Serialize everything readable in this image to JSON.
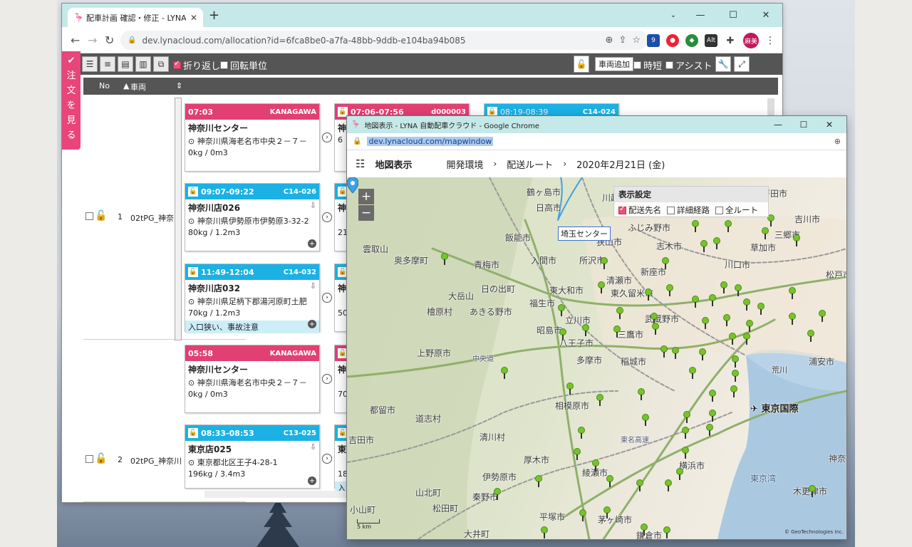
{
  "main_window": {
    "tab_title": "配車計画 確認・修正 - LYNA 自動",
    "url": "dev.lynacloud.com/allocation?id=6fca8be0-a7fa-48bb-9ddb-e104ba94b085",
    "avatar_label": "麻美"
  },
  "toolbar": {
    "wrap_label": "折り返し",
    "rotation_label": "回転単位",
    "add_vehicle_label": "車両追加",
    "shortcut_label": "時短",
    "assist_label": "アシスト"
  },
  "side_button": {
    "label_chars": [
      "注",
      "文",
      "を",
      "見",
      "る"
    ]
  },
  "table": {
    "col_no": "No",
    "col_vehicle": "車両"
  },
  "rows": [
    {
      "no": "1",
      "vehicle": "02tPG_神奈"
    },
    {
      "no": "2",
      "vehicle": "02tPG_神奈川"
    }
  ],
  "cards": [
    {
      "time": "07:03",
      "code": "KANAGAWA",
      "name": "神奈川センター",
      "address": "神奈川県海老名市中央２－７－",
      "load": "0kg / 0m3"
    },
    {
      "time": "09:07-09:22",
      "code": "C14-026",
      "name": "神奈川店026",
      "address": "神奈川県伊勢原市伊勢原3-32-2",
      "load": "80kg / 1.2m3"
    },
    {
      "time": "11:49-12:04",
      "code": "C14-032",
      "name": "神奈川店032",
      "address": "神奈川県足柄下郡湯河原町土肥",
      "load": "70kg / 1.2m3",
      "note": "入口狭い、事故注意"
    },
    {
      "time": "05:58",
      "code": "KANAGAWA",
      "name": "神奈川センター",
      "address": "神奈川県海老名市中央２－７－",
      "load": "0kg / 0m3"
    },
    {
      "time": "08:33-08:53",
      "code": "C13-025",
      "name": "東京店025",
      "address": "東京都北区王子4-28-1",
      "load": "196kg / 3.4m3"
    }
  ],
  "cards_col2": [
    {
      "time": "07:06-07:56",
      "code": "d000003"
    },
    {
      "time": "08:19-08:39",
      "code": "C14-024"
    }
  ],
  "cards_col2_fragments": [
    "神奈",
    "6",
    "神奈",
    "21",
    "神奈",
    "50",
    "神奈",
    "70",
    "東京",
    "18",
    "入"
  ],
  "map_window": {
    "title": "地図表示 - LYNA 自動配車クラウド - Google Chrome",
    "url": "dev.lynacloud.com/mapwindow",
    "header_title": "地図表示",
    "crumbs": [
      "開発環境",
      "配送ルート",
      "2020年2月21日 (金)"
    ],
    "settings_title": "表示設定",
    "opt_destination": "配送先名",
    "opt_detail_route": "詳細経路",
    "opt_all_routes": "全ルート",
    "center_label": "埼玉センター",
    "scale": "5 km",
    "copyright": "© GeoTechnologies Inc."
  },
  "places": [
    {
      "name": "鶴ヶ島市"
    },
    {
      "name": "日高市"
    },
    {
      "name": "川越"
    },
    {
      "name": "ふじみ野市"
    },
    {
      "name": "戸田市"
    },
    {
      "name": "吉川市"
    },
    {
      "name": "三郷市"
    },
    {
      "name": "飯能市"
    },
    {
      "name": "狭山市"
    },
    {
      "name": "志木市"
    },
    {
      "name": "草加市"
    },
    {
      "name": "雲取山"
    },
    {
      "name": "奥多摩町"
    },
    {
      "name": "入間市"
    },
    {
      "name": "所沢市"
    },
    {
      "name": "青梅市"
    },
    {
      "name": "清瀬市"
    },
    {
      "name": "新座市"
    },
    {
      "name": "川口市"
    },
    {
      "name": "松戸市"
    },
    {
      "name": "大岳山"
    },
    {
      "name": "日の出町"
    },
    {
      "name": "東大和市"
    },
    {
      "name": "東久留米市"
    },
    {
      "name": "檜原村"
    },
    {
      "name": "あきる野市"
    },
    {
      "name": "福生市"
    },
    {
      "name": "立川市"
    },
    {
      "name": "武蔵野市"
    },
    {
      "name": "昭島市"
    },
    {
      "name": "三鷹市"
    },
    {
      "name": "上野原市"
    },
    {
      "name": "八王子市"
    },
    {
      "name": "多摩市"
    },
    {
      "name": "稲城市"
    },
    {
      "name": "浦安市"
    },
    {
      "name": "中央道"
    },
    {
      "name": "荒川"
    },
    {
      "name": "相模原市"
    },
    {
      "name": "都留市"
    },
    {
      "name": "道志村"
    },
    {
      "name": "東京国際"
    },
    {
      "name": "吉田市"
    },
    {
      "name": "清川村"
    },
    {
      "name": "厚木市"
    },
    {
      "name": "横浜市"
    },
    {
      "name": "東名高速"
    },
    {
      "name": "神奈"
    },
    {
      "name": "綾瀬市"
    },
    {
      "name": "東京湾"
    },
    {
      "name": "伊勢原市"
    },
    {
      "name": "山北町"
    },
    {
      "name": "秦野市"
    },
    {
      "name": "木更津市"
    },
    {
      "name": "小山町"
    },
    {
      "name": "松田町"
    },
    {
      "name": "平塚市"
    },
    {
      "name": "茅ヶ崎市"
    },
    {
      "name": "大井町"
    },
    {
      "name": "鎌倉市"
    }
  ],
  "colors": {
    "pink": "#e23f73",
    "blue": "#1bb1e4",
    "toolbar_dark": "#555555",
    "tab_strip": "#c5e9e8",
    "pin_green": "#77c32b"
  }
}
